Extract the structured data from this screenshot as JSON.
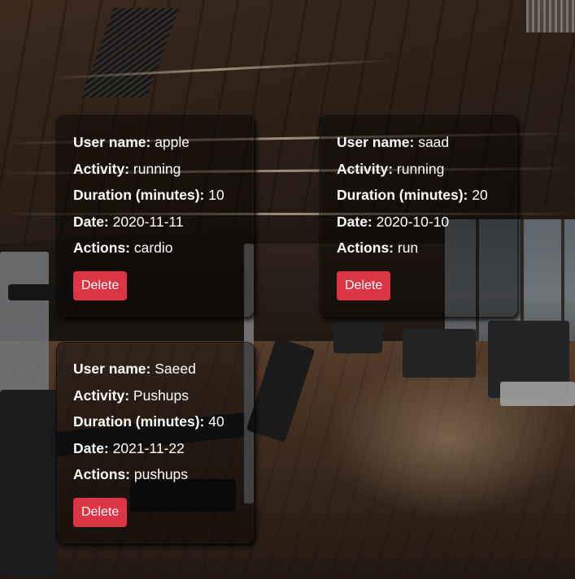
{
  "labels": {
    "user_name": "User name:",
    "activity": "Activity:",
    "duration": "Duration (minutes):",
    "date": "Date:",
    "actions": "Actions:"
  },
  "exercises": [
    {
      "user_name": "apple",
      "activity": "running",
      "duration": "10",
      "date": "2020-11-11",
      "actions": "cardio",
      "delete_label": "Delete"
    },
    {
      "user_name": "saad",
      "activity": "running",
      "duration": "20",
      "date": "2020-10-10",
      "actions": "run",
      "delete_label": "Delete"
    },
    {
      "user_name": "Saeed",
      "activity": "Pushups",
      "duration": "40",
      "date": "2021-11-22",
      "actions": "pushups",
      "delete_label": "Delete"
    }
  ],
  "colors": {
    "delete_button": "#dc3545",
    "card_background": "rgba(0,0,0,0.42)",
    "text": "#ffffff"
  }
}
